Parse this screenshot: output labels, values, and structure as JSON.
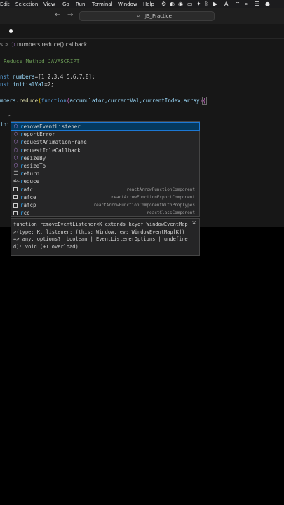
{
  "menubar": {
    "items": [
      "Edit",
      "Selection",
      "View",
      "Go",
      "Run",
      "Terminal",
      "Window",
      "Help"
    ]
  },
  "titlebar": {
    "back_icon": "arrow-left-icon",
    "forward_icon": "arrow-right-icon",
    "search_icon": "search-icon",
    "workspace": "JS_Practice"
  },
  "breadcrumb": {
    "prefix": "s",
    "separator": ">",
    "symbol": "numbers.reduce() callback"
  },
  "code": {
    "line1": "Reduce Method JAVASCRIPT",
    "line2_kw": "nst",
    "line2_var": "numbers",
    "line2_rest": "=[1,2,3,4,5,6,7,8];",
    "line3_kw": "nst",
    "line3_var": "initialVal",
    "line3_rest": "=2;",
    "line4_obj": "mbers",
    "line4_method": "reduce",
    "line4_fn": "function",
    "line4_params": "accumulator,currentVal,currentIndex,array",
    "line5_typed": "r",
    "line6_partial": "ini"
  },
  "suggest": {
    "items": [
      {
        "label": "removeEventListener",
        "match": "r",
        "kind": "method",
        "detail": ""
      },
      {
        "label": "reportError",
        "match": "r",
        "kind": "method",
        "detail": ""
      },
      {
        "label": "requestAnimationFrame",
        "match": "r",
        "kind": "method",
        "detail": ""
      },
      {
        "label": "requestIdleCallback",
        "match": "r",
        "kind": "method",
        "detail": ""
      },
      {
        "label": "resizeBy",
        "match": "r",
        "kind": "method",
        "detail": ""
      },
      {
        "label": "resizeTo",
        "match": "r",
        "kind": "method",
        "detail": ""
      },
      {
        "label": "return",
        "match": "r",
        "kind": "keyword",
        "detail": ""
      },
      {
        "label": "reduce",
        "match": "r",
        "kind": "text",
        "detail": ""
      },
      {
        "label": "rafc",
        "match": "r",
        "kind": "snippet",
        "detail": "reactArrowFunctionComponent"
      },
      {
        "label": "rafce",
        "match": "r",
        "kind": "snippet",
        "detail": "reactArrowFunctionExportComponent"
      },
      {
        "label": "rafcp",
        "match": "r",
        "kind": "snippet",
        "detail": "reactArrowFunctionComponentWithPropTypes"
      },
      {
        "label": "rcc",
        "match": "r",
        "kind": "snippet",
        "detail": "reactClassComponent"
      }
    ],
    "selected_index": 0
  },
  "docs": {
    "signature": "function removeEventListener<K extends keyof WindowEventMap>(type: K, listener: (this: Window, ev: WindowEventMap[K]) => any, options?: boolean | EventListenerOptions | undefined): void (+1 overload)",
    "close_icon": "close-icon"
  },
  "colors": {
    "background": "#000000",
    "editor_bg": "#171717",
    "widget_bg": "#252526",
    "selection": "#04395e",
    "match": "#2aaaff",
    "method_icon": "#b180d7"
  }
}
